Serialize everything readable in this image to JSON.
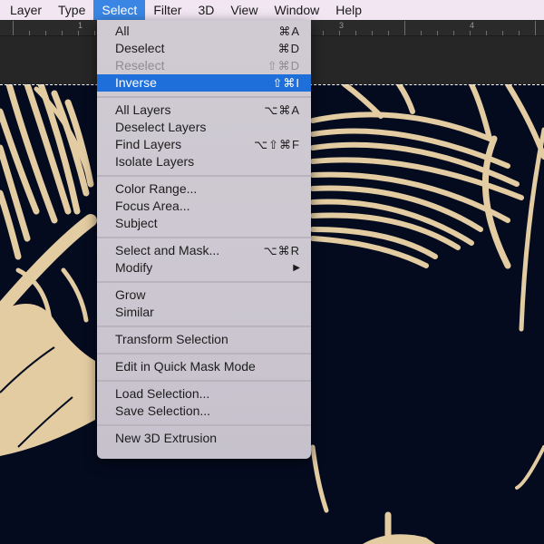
{
  "menubar": {
    "items": [
      {
        "label": "Layer"
      },
      {
        "label": "Type"
      },
      {
        "label": "Select",
        "active": true
      },
      {
        "label": "Filter"
      },
      {
        "label": "3D"
      },
      {
        "label": "View"
      },
      {
        "label": "Window"
      },
      {
        "label": "Help"
      }
    ]
  },
  "ruler": {
    "labels": [
      "1",
      "3",
      "4"
    ]
  },
  "select_menu": {
    "groups": [
      [
        {
          "label": "All",
          "shortcut": "⌘A"
        },
        {
          "label": "Deselect",
          "shortcut": "⌘D"
        },
        {
          "label": "Reselect",
          "shortcut": "⇧⌘D",
          "disabled": true
        },
        {
          "label": "Inverse",
          "shortcut": "⇧⌘I",
          "highlighted": true
        }
      ],
      [
        {
          "label": "All Layers",
          "shortcut": "⌥⌘A"
        },
        {
          "label": "Deselect Layers",
          "shortcut": ""
        },
        {
          "label": "Find Layers",
          "shortcut": "⌥⇧⌘F"
        },
        {
          "label": "Isolate Layers",
          "shortcut": ""
        }
      ],
      [
        {
          "label": "Color Range...",
          "shortcut": ""
        },
        {
          "label": "Focus Area...",
          "shortcut": ""
        },
        {
          "label": "Subject",
          "shortcut": ""
        }
      ],
      [
        {
          "label": "Select and Mask...",
          "shortcut": "⌥⌘R"
        },
        {
          "label": "Modify",
          "shortcut": "",
          "submenu": true
        }
      ],
      [
        {
          "label": "Grow",
          "shortcut": ""
        },
        {
          "label": "Similar",
          "shortcut": ""
        }
      ],
      [
        {
          "label": "Transform Selection",
          "shortcut": ""
        }
      ],
      [
        {
          "label": "Edit in Quick Mask Mode",
          "shortcut": ""
        }
      ],
      [
        {
          "label": "Load Selection...",
          "shortcut": ""
        },
        {
          "label": "Save Selection...",
          "shortcut": ""
        }
      ],
      [
        {
          "label": "New 3D Extrusion",
          "shortcut": ""
        }
      ]
    ],
    "submenu_icon": "▶"
  },
  "colors": {
    "canvas_bg": "#040b1f",
    "artwork": "#e3cca2",
    "highlight": "#1e6fd9"
  }
}
